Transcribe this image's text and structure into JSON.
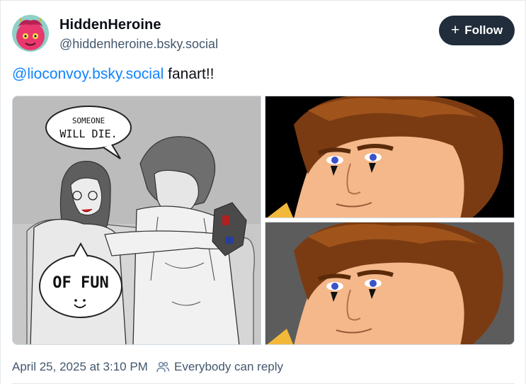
{
  "author": {
    "display_name": "HiddenHeroine",
    "handle": "@hiddenheroine.bsky.social"
  },
  "follow_button": {
    "icon": "plus-icon",
    "label": "Follow"
  },
  "post": {
    "mention": "@lioconvoy.bsky.social",
    "text": " fanart!!",
    "images": [
      {
        "position": "left",
        "speech_bubble_top": [
          "SOMEONE",
          "WILL DIE."
        ],
        "speech_bubble_bottom": "OF FUN"
      },
      {
        "position": "top-right"
      },
      {
        "position": "bottom-right"
      }
    ]
  },
  "footer": {
    "timestamp": "April 25, 2025 at 3:10 PM",
    "reply_icon": "people-icon",
    "reply_setting": "Everybody can reply"
  },
  "colors": {
    "link": "#1083fe",
    "follow_bg": "#212d3b",
    "secondary_text": "#42576c"
  }
}
